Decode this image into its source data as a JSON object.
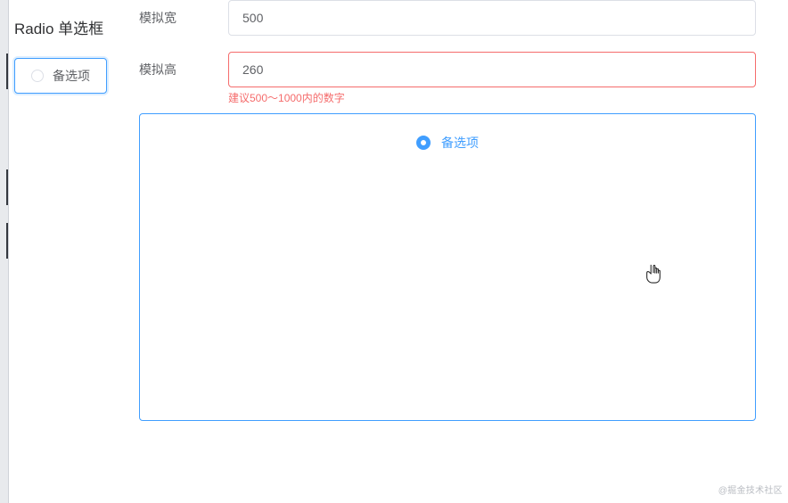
{
  "sidebar": {
    "title": "Radio 单选框",
    "option": {
      "label": "备选项"
    }
  },
  "form": {
    "width": {
      "label": "模拟宽",
      "value": "500"
    },
    "height": {
      "label": "模拟高",
      "value": "260",
      "error": "建议500～1000内的数字"
    }
  },
  "preview": {
    "radio": {
      "label": "备选项"
    }
  },
  "watermark": "@掘金技术社区"
}
